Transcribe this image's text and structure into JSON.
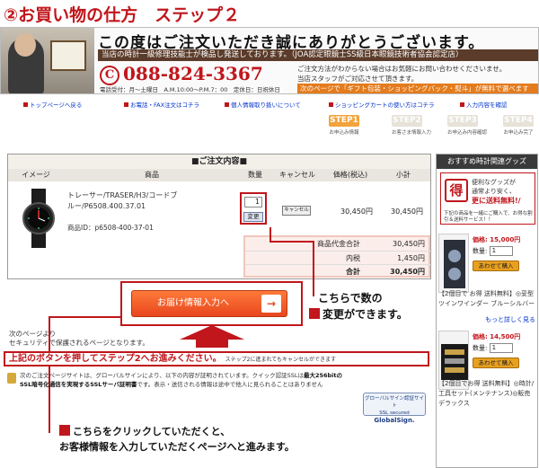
{
  "page": {
    "title": "②お買い物の仕方　ステップ２"
  },
  "banner": {
    "thanks": "この度はご注文いただき誠にありがとうございます。",
    "qualification": "当店の時計一級修理技能士が検品し発送しております。（JOA認定眼鏡士SS級日本眼鏡技術者協会認定店）",
    "phone_symbol": "C",
    "phone": "088-824-3367",
    "hours": "電話受付：月〜土曜日　A.M.10:00〜P.M.7：00　定休日：日祝休日",
    "note1": "ご注文方法がわからない場合はお気軽にお問い合わせくださいませ。",
    "note2": "当店スタッフがご対応させて頂きます。",
    "note3": "次のページで「ギフト包装・ショッピングバック・熨斗」が無料で選べます"
  },
  "links": [
    "トップページへ戻る",
    "お電話・FAX注文はコチラ",
    "個人情報取り扱いについて",
    "ショッピングカートの使い方はコチラ",
    "入力内容を確認"
  ],
  "steps": [
    {
      "num": "STEP1",
      "label": "お申込み情報"
    },
    {
      "num": "STEP2",
      "label": "お客さま情報入力"
    },
    {
      "num": "STEP3",
      "label": "お申込み内容確認"
    },
    {
      "num": "STEP4",
      "label": "お申込み完了"
    }
  ],
  "order": {
    "heading": "■ご注文内容■",
    "columns": [
      "イメージ",
      "商品",
      "数量",
      "キャンセル",
      "価格(税込)",
      "小計"
    ],
    "product_name": "トレーサー/TRASER/H3/コードブルー/P6508.400.37.01",
    "product_id": "商品ID：p6508-400-37-01",
    "quantity": "1",
    "change_button": "変更",
    "cancel_button": "キャンセル",
    "price": "30,450円",
    "subtotal": "30,450円",
    "summary": [
      {
        "label": "商品代金合計",
        "value": "30,450円"
      },
      {
        "label": "内税",
        "value": "1,450円"
      },
      {
        "label": "合計",
        "value": "30,450円"
      }
    ]
  },
  "callouts": {
    "quantity_note_line1": "こちらで数の",
    "quantity_note_line2": "変更ができます。",
    "click_note_line1": "こちらをクリックしていただくと、",
    "click_note_line2": "お客様情報を入力していただくページへと進みます。"
  },
  "main_button": {
    "label": "お届け情報入力へ",
    "arrow": "→"
  },
  "security_notice_line1": "次のページより",
  "security_notice_line2": "セキュリティで保護されるページとなります。",
  "proceed": {
    "text": "上記のボタンを押してステップ2へお進みください。",
    "small": "ステップ2に進まれてもキャンセルができます"
  },
  "ssl": {
    "text1": "次のご注文ページサイトは、グローバルサインにより、以下の内容が証明されています。クイック認証SSLは",
    "bold1": "最大256bitの",
    "bold2": "SSL暗号化通信を実現するSSLサーバ証明書",
    "text2": "です。表示・送信される情報は途中で他人に見られることはありません",
    "badge_line1": "グローバルサイン認証サイト",
    "badge_line2": "SSL secured",
    "badge_line3": "GlobalSign."
  },
  "sidebar": {
    "header": "おすすめ時計関連グッズ",
    "banner_toku": "得",
    "banner_line1": "便利なグッズが",
    "banner_line2": "通常より安く、",
    "banner_line3": "更に送料無料!/",
    "banner_bottom": "下記の商品を一緒にご購入で、お得な割引＆送料サービス！！",
    "items": [
      {
        "price": "価格: 15,000円",
        "qty_label": "数量:",
        "qty": "1",
        "cart": "あわせて購入",
        "desc": "【2個目で お得 送料無料】◎妥型ツインワインダー ブルーシルバー"
      },
      {
        "price": "価格: 14,500円",
        "qty_label": "数量:",
        "qty": "1",
        "cart": "あわせて購入",
        "desc": "【2個目でお得 送料無料】◎時計/工具セット(メンテナンス)◎販売 デラックス"
      }
    ],
    "more_link": "もっと詳しく見る"
  },
  "colors": {
    "accent_red": "#c0161c",
    "button_orange": "#e8461e",
    "step_active": "#f3a33b"
  }
}
